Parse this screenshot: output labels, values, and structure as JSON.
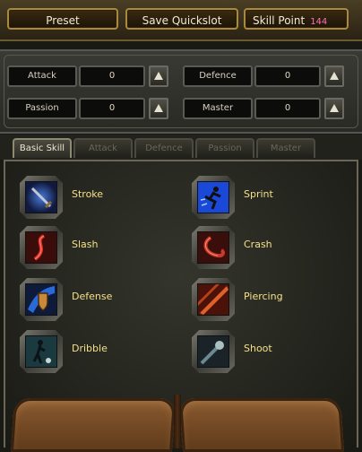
{
  "topbar": {
    "preset_label": "Preset",
    "save_quickslot_label": "Save Quickslot",
    "skill_point_label": "Skill Point",
    "skill_point_value": "144"
  },
  "stats": [
    {
      "label": "Attack",
      "value": "0"
    },
    {
      "label": "Defence",
      "value": "0"
    },
    {
      "label": "Passion",
      "value": "0"
    },
    {
      "label": "Master",
      "value": "0"
    }
  ],
  "tabs": [
    {
      "label": "Basic Skill",
      "active": true
    },
    {
      "label": "Attack",
      "active": false
    },
    {
      "label": "Defence",
      "active": false
    },
    {
      "label": "Passion",
      "active": false
    },
    {
      "label": "Master",
      "active": false
    }
  ],
  "skills": [
    {
      "name": "Stroke",
      "icon": "sword-icon"
    },
    {
      "name": "Sprint",
      "icon": "sprint-icon"
    },
    {
      "name": "Slash",
      "icon": "slash-icon"
    },
    {
      "name": "Crash",
      "icon": "crash-icon"
    },
    {
      "name": "Defense",
      "icon": "shield-icon"
    },
    {
      "name": "Piercing",
      "icon": "piercing-icon"
    },
    {
      "name": "Dribble",
      "icon": "dribble-icon"
    },
    {
      "name": "Shoot",
      "icon": "shoot-icon"
    }
  ],
  "colors": {
    "skill_point_accent": "#ff70b0",
    "skill_name": "#f4e08a",
    "button_border": "#a88a3e"
  }
}
